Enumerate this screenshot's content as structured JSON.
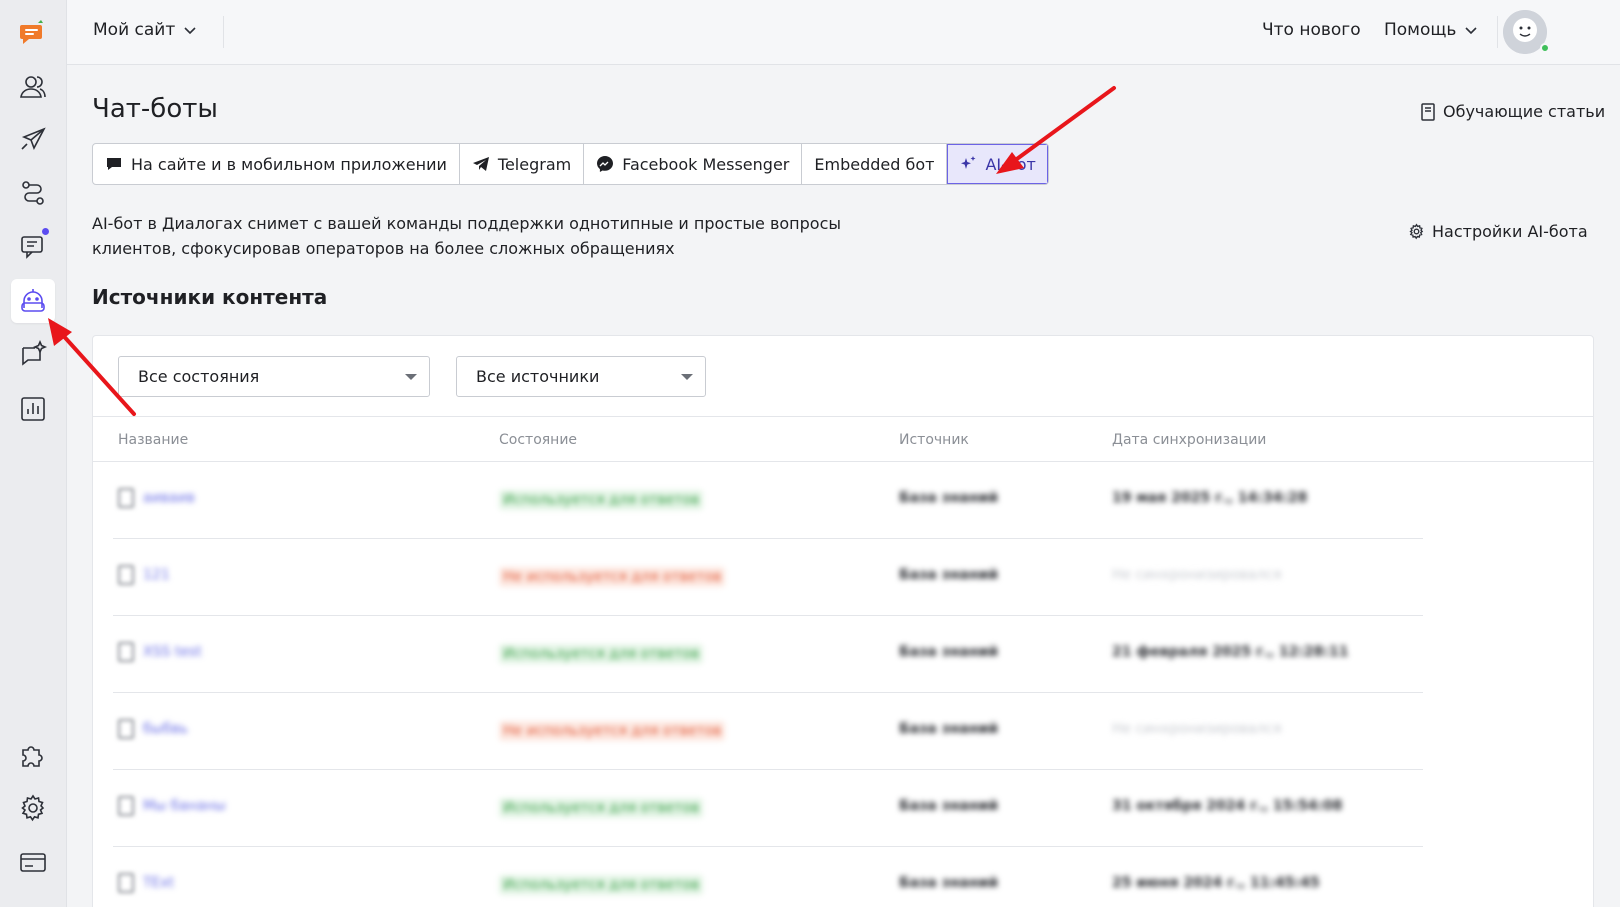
{
  "header": {
    "site_selector": "Мой сайт",
    "whats_new": "Что нового",
    "help": "Помощь"
  },
  "sidebar": {
    "items": [
      {
        "icon": "chat-logo-icon"
      },
      {
        "icon": "users-icon"
      },
      {
        "icon": "rocket-icon"
      },
      {
        "icon": "route-icon"
      },
      {
        "icon": "messages-icon",
        "badge": true
      },
      {
        "icon": "bot-icon",
        "active": true
      },
      {
        "icon": "ai-sparkle-icon"
      },
      {
        "icon": "reports-icon"
      },
      {
        "icon": "puzzle-icon"
      },
      {
        "icon": "gear-icon"
      },
      {
        "icon": "billing-icon"
      }
    ]
  },
  "page": {
    "title": "Чат-боты",
    "guides_link": "Обучающие статьи",
    "tabs": [
      {
        "label": "На сайте и в мобильном приложении",
        "icon": "chat-bubble-icon"
      },
      {
        "label": "Telegram",
        "icon": "telegram-icon"
      },
      {
        "label": "Facebook Messenger",
        "icon": "messenger-icon"
      },
      {
        "label": "Embedded бот",
        "icon": ""
      },
      {
        "label": "AI-бот",
        "icon": "sparkle-icon",
        "active": true
      }
    ],
    "description": "AI-бот в Диалогах снимет с вашей команды поддержки однотипные и простые вопросы клиентов, сфокусировав операторов на более сложных обращениях",
    "settings_link": "Настройки AI-бота",
    "section_title": "Источники контента"
  },
  "filters": {
    "state": "Все состояния",
    "source": "Все источники"
  },
  "table": {
    "columns": [
      "Название",
      "Состояние",
      "Источник",
      "Дата синхронизации"
    ],
    "rows": [
      {
        "name": "аиваив",
        "status": "Используется для ответов",
        "status_ok": true,
        "source": "База знаний",
        "date": "19 мая 2025 г., 14:34:28",
        "synced": true
      },
      {
        "name": "121",
        "status": "Не используется для ответов",
        "status_ok": false,
        "source": "База знаний",
        "date": "Не синхронизировался",
        "synced": false
      },
      {
        "name": "XSS test",
        "status": "Используется для ответов",
        "status_ok": true,
        "source": "База знаний",
        "date": "21 февраля 2025 г., 12:28:11",
        "synced": true
      },
      {
        "name": "быбвь",
        "status": "Не используется для ответов",
        "status_ok": false,
        "source": "База знаний",
        "date": "Не синхронизировался",
        "synced": false
      },
      {
        "name": "Мы бананы",
        "status": "Используется для ответов",
        "status_ok": true,
        "source": "База знаний",
        "date": "31 октября 2024 г., 15:54:08",
        "synced": true
      },
      {
        "name": "TExt",
        "status": "Используется для ответов",
        "status_ok": true,
        "source": "База знаний",
        "date": "25 июня 2024 г., 11:45:45",
        "synced": true
      }
    ]
  },
  "colors": {
    "accent": "#5b4cf0",
    "arrow": "#e8161b",
    "ok": "#3ba14a",
    "not_used": "#e25b3a"
  }
}
